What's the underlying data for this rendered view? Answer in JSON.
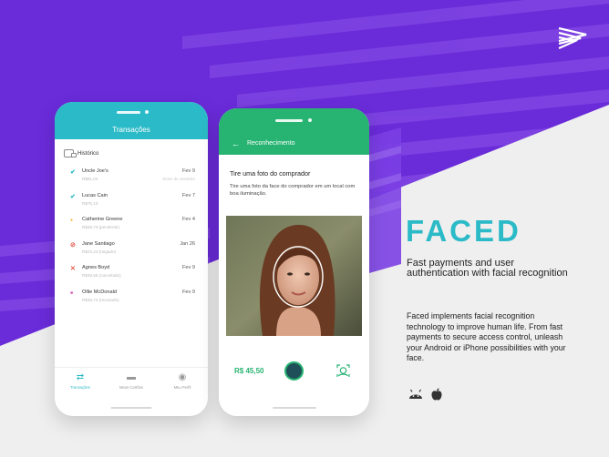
{
  "logo": {
    "icon": "stacked-chevrons-logo-icon"
  },
  "transactions_app": {
    "title": "Transações",
    "history_label": "Histórico",
    "items": [
      {
        "icon": "check-icon",
        "color": "#2bbac7",
        "name": "Uncle Joe's",
        "amount": "R$81,04",
        "date": "Fev 9",
        "note": "Nome do vendedor"
      },
      {
        "icon": "check-icon",
        "color": "#2bbac7",
        "name": "Lucas Cain",
        "amount": "R$75,10",
        "date": "Fev 7",
        "note": ""
      },
      {
        "icon": "dot-icon",
        "color": "#f2b533",
        "name": "Catherine Greene",
        "amount": "R$48,73 (pendente)",
        "date": "Fev 4",
        "note": ""
      },
      {
        "icon": "blocked-icon",
        "color": "#e4574b",
        "name": "Jane Santiago",
        "amount": "R$23,43 (negado)",
        "date": "Jan 26",
        "note": ""
      },
      {
        "icon": "cross-icon",
        "color": "#e4574b",
        "name": "Agnes Boyd",
        "amount": "R$48,56 (cancelado)",
        "date": "Fev 9",
        "note": ""
      },
      {
        "icon": "square-icon",
        "color": "#d95ab8",
        "name": "Ollie McDonald",
        "amount": "R$48,73 (recusado)",
        "date": "Fev 9",
        "note": ""
      }
    ],
    "tabs": [
      {
        "label": "Transações",
        "icon": "transfer-arrows-icon",
        "active": true
      },
      {
        "label": "Meus Cartões",
        "icon": "card-icon",
        "active": false
      },
      {
        "label": "Meu Perfil",
        "icon": "profile-icon",
        "active": false
      }
    ]
  },
  "recognition_app": {
    "title": "Reconhecimento",
    "heading": "Tire uma foto do comprador",
    "description": "Tire uma foto da face do comprador em um local com boa iluminação.",
    "price": "R$ 45,50",
    "shutter_icon": "shutter-button-icon",
    "face_icon": "face-scan-icon"
  },
  "product": {
    "name": "FACED",
    "tagline": "Fast payments and user authentication with facial recognition",
    "body": "Faced implements facial recognition technology to improve human life. From fast payments to secure access control, unleash your Android or iPhone possibilities with your face.",
    "platform_icons": [
      "android-icon",
      "apple-icon"
    ]
  },
  "colors": {
    "brand_purple": "#6a2bd9",
    "teal": "#2bbac7",
    "green": "#27b472"
  }
}
